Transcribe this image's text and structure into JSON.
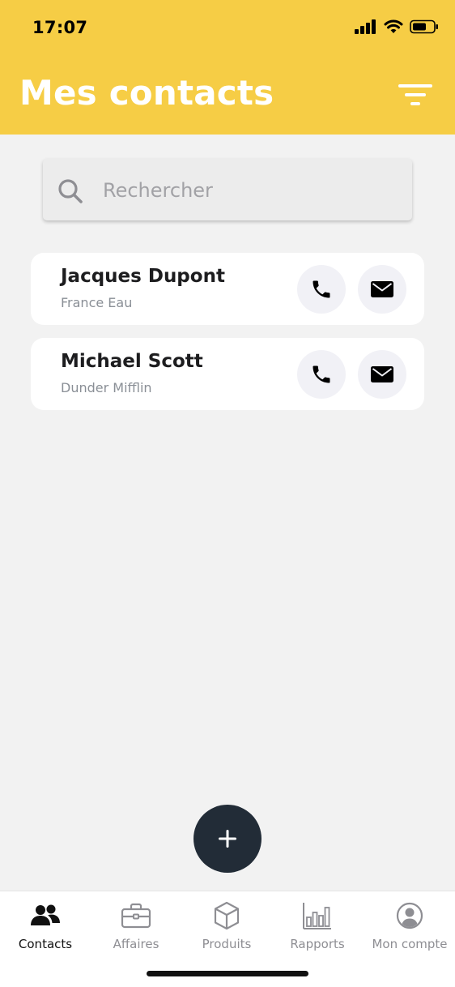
{
  "status_bar": {
    "time": "17:07"
  },
  "header": {
    "title": "Mes contacts",
    "background_color": "#f6cd45",
    "filter_icon": "filter-lines-icon"
  },
  "search": {
    "placeholder": "Rechercher",
    "value": "",
    "icon": "search-icon"
  },
  "contacts": [
    {
      "name": "Jacques Dupont",
      "company": "France Eau"
    },
    {
      "name": "Michael Scott",
      "company": "Dunder Mifflin"
    }
  ],
  "fab": {
    "icon": "plus-icon",
    "color": "#222c37"
  },
  "bottom_nav": {
    "items": [
      {
        "label": "Contacts",
        "icon": "contacts-icon",
        "active": true
      },
      {
        "label": "Affaires",
        "icon": "briefcase-icon",
        "active": false
      },
      {
        "label": "Produits",
        "icon": "box-icon",
        "active": false
      },
      {
        "label": "Rapports",
        "icon": "bar-chart-icon",
        "active": false
      },
      {
        "label": "Mon compte",
        "icon": "account-icon",
        "active": false
      }
    ]
  }
}
